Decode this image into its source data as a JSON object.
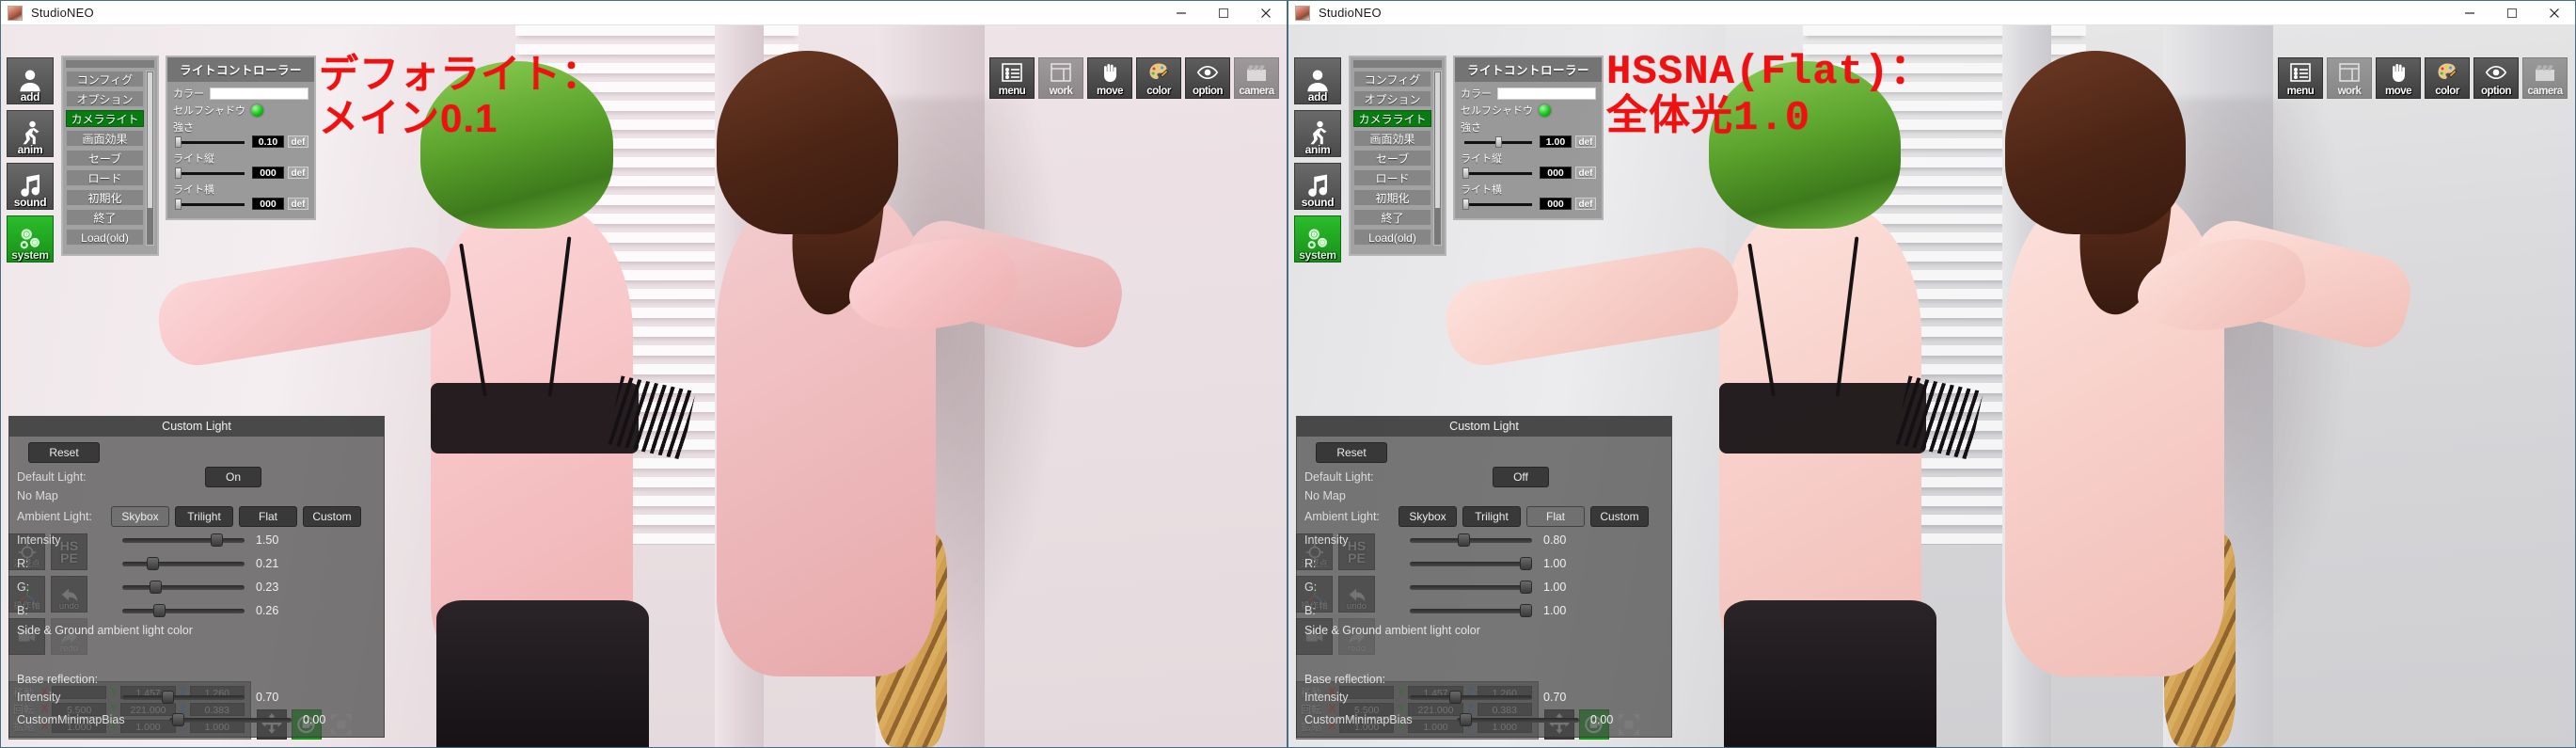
{
  "window": {
    "title": "StudioNEO",
    "controls": {
      "minimize": "minimize-icon",
      "maximize": "maximize-icon",
      "close": "close-icon"
    }
  },
  "rail": [
    {
      "name": "add",
      "label": "add",
      "icon": "person-add-icon",
      "active": false
    },
    {
      "name": "anim",
      "label": "anim",
      "icon": "running-person-icon",
      "active": false
    },
    {
      "name": "sound",
      "label": "sound",
      "icon": "music-note-icon",
      "active": false
    },
    {
      "name": "system",
      "label": "system",
      "icon": "gears-icon",
      "active": true
    }
  ],
  "menu": {
    "items": [
      {
        "label": "コンフィグ",
        "active": false
      },
      {
        "label": "オプション",
        "active": false
      },
      {
        "label": "カメラライト",
        "active": true
      },
      {
        "label": "画面効果",
        "active": false
      },
      {
        "label": "セーブ",
        "active": false
      },
      {
        "label": "ロード",
        "active": false
      },
      {
        "label": "初期化",
        "active": false
      },
      {
        "label": "終了",
        "active": false
      },
      {
        "label": "Load(old)",
        "active": false
      }
    ]
  },
  "light_controller": {
    "title": "ライトコントローラー",
    "color_label": "カラー",
    "self_shadow_label": "セルフシャドウ",
    "self_shadow_on": true,
    "strength_label": "強さ",
    "light_vertical_label": "ライト縦",
    "light_horizontal_label": "ライト横",
    "def_label": "def",
    "left": {
      "strength": "0.10",
      "vertical": "000",
      "horizontal": "000"
    },
    "right": {
      "strength": "1.00",
      "vertical": "000",
      "horizontal": "000"
    }
  },
  "toolbar": [
    {
      "label": "menu",
      "icon": "list-menu-icon",
      "faded": false
    },
    {
      "label": "work",
      "icon": "window-pane-icon",
      "faded": true
    },
    {
      "label": "move",
      "icon": "hand-icon",
      "faded": false
    },
    {
      "label": "color",
      "icon": "palette-icon",
      "faded": false
    },
    {
      "label": "option",
      "icon": "eye-icon",
      "faded": false
    },
    {
      "label": "camera",
      "icon": "clapperboard-icon",
      "faded": true
    }
  ],
  "annotations": {
    "left": "デフォライト：\nメイン0.1",
    "right": "HSSNA(Flat)：\n全体光1.0",
    "color": "#ee1111"
  },
  "custom_light": {
    "title": "Custom Light",
    "reset_label": "Reset",
    "default_light_label": "Default Light:",
    "no_map_label": "No Map",
    "ambient_light_label": "Ambient Light:",
    "ambient_options": [
      "Skybox",
      "Trilight",
      "Flat",
      "Custom"
    ],
    "intensity_label": "Intensity",
    "r_label": "R:",
    "g_label": "G:",
    "b_label": "B:",
    "side_ground_label": "Side & Ground ambient light color",
    "base_reflection_label": "Base reflection:",
    "base_intensity_label": "Intensity",
    "custom_minimap_bias_label": "CustomMinimapBias",
    "left": {
      "default_light_state": "On",
      "ambient_selected": "Skybox",
      "intensity": "1.50",
      "r": "0.21",
      "g": "0.23",
      "b": "0.26",
      "base_intensity": "0.70",
      "minimap_bias": "0.00"
    },
    "right": {
      "default_light_state": "Off",
      "ambient_selected": "Flat",
      "intensity": "0.80",
      "r": "1.00",
      "g": "1.00",
      "b": "1.00",
      "base_intensity": "0.70",
      "minimap_bias": "0.00"
    }
  },
  "mini_icons": [
    {
      "label": "注視点",
      "icon": "target-point-icon",
      "dimmed": false
    },
    {
      "label": "HS\nPE",
      "icon": "hspe-text-icon",
      "dimmed": false
    },
    {
      "label": "操作軸",
      "icon": "axis-gizmo-icon",
      "dimmed": false
    },
    {
      "label": "undo",
      "icon": "undo-arrow-icon",
      "dimmed": false
    },
    {
      "label": "",
      "icon": "camera-icon",
      "dimmed": false
    },
    {
      "label": "redo",
      "icon": "redo-arrow-icon",
      "dimmed": true
    },
    {
      "label": "MAP",
      "icon": "map-icon",
      "dimmed": true
    }
  ],
  "transform": {
    "rows": [
      {
        "name": "移動",
        "x": "",
        "y": "1.457",
        "z": "1.260"
      },
      {
        "name": "回転",
        "x": "5.500",
        "y": "221.000",
        "z": "0.383"
      },
      {
        "name": "拡縮",
        "x": "1.000",
        "y": "1.000",
        "z": "1.000"
      }
    ],
    "axes": {
      "x": "X",
      "y": "Y",
      "z": "Z"
    },
    "tools": [
      {
        "name": "move-gizmo-tool",
        "icon": "four-arrows-icon"
      },
      {
        "name": "rotate-gizmo-tool",
        "icon": "rotate-icon"
      },
      {
        "name": "scale-gizmo-tool",
        "icon": "expand-arrows-icon"
      }
    ]
  }
}
